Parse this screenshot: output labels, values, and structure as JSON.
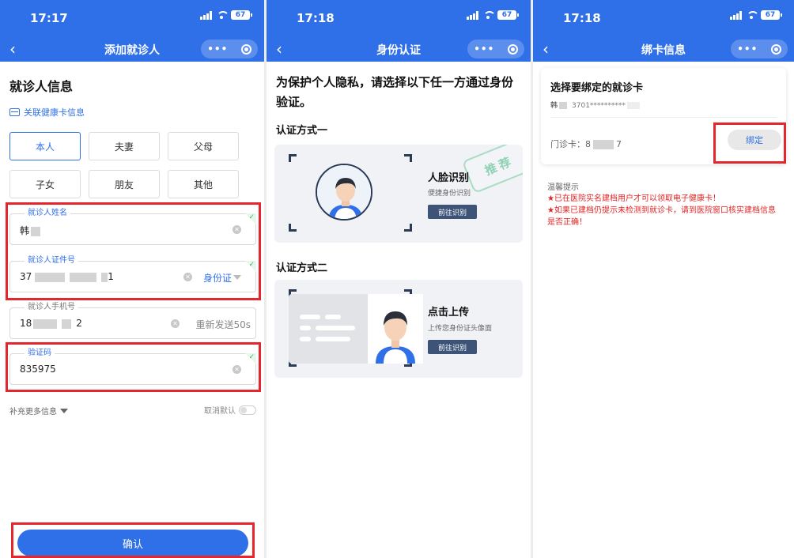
{
  "status": {
    "time1": "17:17",
    "time2": "17:18",
    "time3": "17:18",
    "battery": "67"
  },
  "capsule": {
    "more": "•••"
  },
  "panel1": {
    "nav_title": "添加就诊人",
    "section_title": "就诊人信息",
    "link_health_card": "关联健康卡信息",
    "relations": [
      "本人",
      "夫妻",
      "父母",
      "子女",
      "朋友",
      "其他"
    ],
    "selected_relation": "本人",
    "name_field": {
      "label": "就诊人姓名",
      "value": "韩"
    },
    "id_field": {
      "label": "就诊人证件号",
      "value_start": "37",
      "value_end": "1",
      "id_type": "身份证"
    },
    "phone_field": {
      "label": "就诊人手机号",
      "value_start": "18",
      "value_end": "2",
      "resend": "重新发送50s"
    },
    "code_field": {
      "label": "验证码",
      "value": "835975"
    },
    "more_info": "补充更多信息",
    "cancel_default": "取消默认",
    "confirm": "确认"
  },
  "panel2": {
    "nav_title": "身份认证",
    "intro": "为保护个人隐私，请选择以下任一方通过身份验证。",
    "method1_title": "认证方式一",
    "method1": {
      "name": "人脸识别",
      "sub": "便捷身份识别",
      "button": "前往识别",
      "stamp": "推荐"
    },
    "method2_title": "认证方式二",
    "method2": {
      "name": "点击上传",
      "sub": "上传您身份证头像面",
      "button": "前往识别"
    }
  },
  "panel3": {
    "nav_title": "绑卡信息",
    "card_title": "选择要绑定的就诊卡",
    "card_name": "韩",
    "card_id": "3701**********",
    "clinic_label": "门诊卡：",
    "clinic_start": "8",
    "clinic_end": "7",
    "bind_button": "绑定",
    "tips_title": "温馨提示",
    "tip1": "★已在医院实名建档用户才可以领取电子健康卡！",
    "tip2": "★如果已建档仍提示未检测到就诊卡，请到医院窗口核实建档信息是否正确！"
  },
  "colors": {
    "primary": "#2f6fe8",
    "highlight": "#e5262c",
    "warning": "#e02424",
    "dark_button": "#3d5478"
  },
  "icons": [
    "back-icon",
    "more-icon",
    "close-target-icon",
    "card-icon",
    "clear-icon",
    "check-icon",
    "dropdown-icon",
    "face-icon",
    "idcard-icon"
  ]
}
